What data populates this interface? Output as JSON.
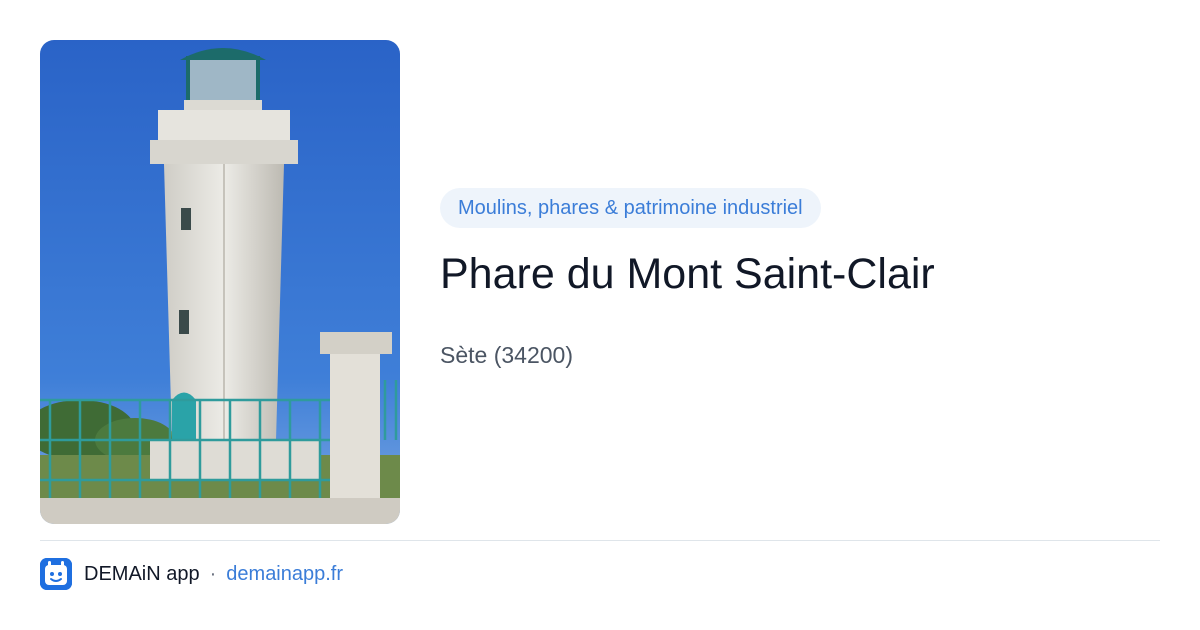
{
  "card": {
    "image_alt": "lighthouse-photo",
    "category": "Moulins, phares & patrimoine industriel",
    "title": "Phare du Mont Saint-Clair",
    "location": "Sète (34200)"
  },
  "footer": {
    "brand": "DEMAiN app",
    "separator": "·",
    "link": "demainapp.fr"
  },
  "colors": {
    "accent": "#3b7dd8",
    "pill_bg": "#eef4fb",
    "title": "#111827",
    "subtitle": "#4b5563",
    "logo": "#1f6fe0"
  }
}
